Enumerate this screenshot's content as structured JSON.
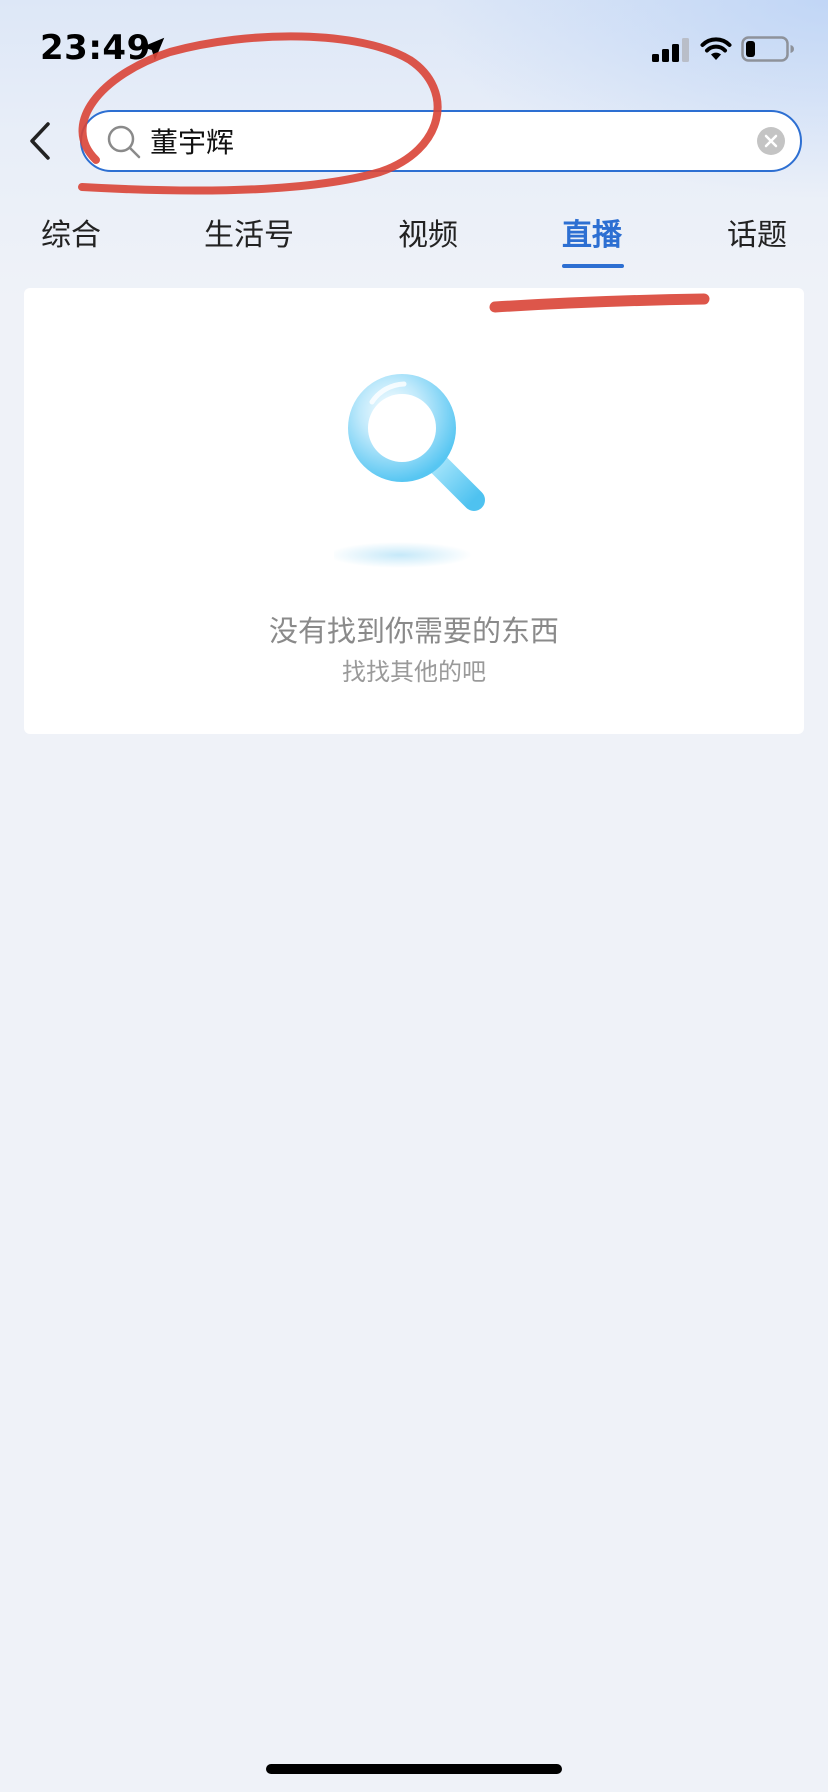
{
  "status_bar": {
    "time": "23:49",
    "location_icon": "location-arrow-icon",
    "signal_icon": "cellular-signal-icon",
    "wifi_icon": "wifi-icon",
    "battery_icon": "battery-icon",
    "battery_level": 0.25
  },
  "header": {
    "back_icon": "chevron-left-icon",
    "search": {
      "value": "董宇辉",
      "placeholder": "",
      "search_icon": "search-icon",
      "clear_icon": "clear-circle-icon"
    }
  },
  "tabs": [
    {
      "label": "综合",
      "active": false
    },
    {
      "label": "生活号",
      "active": false
    },
    {
      "label": "视频",
      "active": false
    },
    {
      "label": "直播",
      "active": true
    },
    {
      "label": "话题",
      "active": false
    }
  ],
  "empty_state": {
    "icon": "magnifier-illustration",
    "title": "没有找到你需要的东西",
    "subtitle": "找找其他的吧"
  },
  "colors": {
    "accent": "#2d6fd2",
    "background": "#eff2f8",
    "annotation": "#d94436"
  }
}
